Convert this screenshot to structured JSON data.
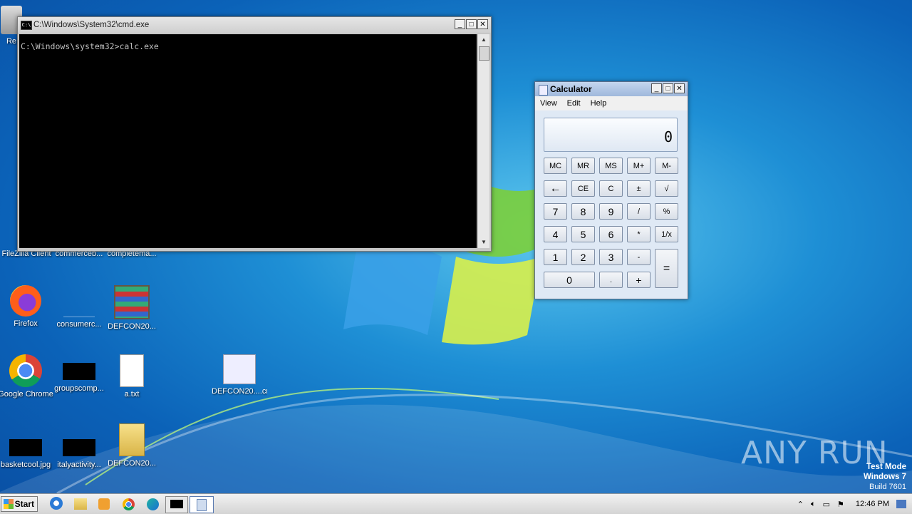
{
  "cmd": {
    "title": "C:\\Windows\\System32\\cmd.exe",
    "icon_text": "C:\\",
    "line": "C:\\Windows\\system32>calc.exe"
  },
  "calculator": {
    "title": "Calculator",
    "menu": [
      "View",
      "Edit",
      "Help"
    ],
    "display": "0",
    "buttons": {
      "mc": "MC",
      "mr": "MR",
      "ms": "MS",
      "mplus": "M+",
      "mminus": "M-",
      "back": "←",
      "ce": "CE",
      "c": "C",
      "pm": "±",
      "sqrt": "√",
      "n7": "7",
      "n8": "8",
      "n9": "9",
      "div": "/",
      "pct": "%",
      "n4": "4",
      "n5": "5",
      "n6": "6",
      "mul": "*",
      "inv": "1/x",
      "n1": "1",
      "n2": "2",
      "n3": "3",
      "sub": "-",
      "eq": "=",
      "n0": "0",
      "dot": ".",
      "add": "+"
    }
  },
  "desktop_icons": [
    {
      "label": "Re"
    },
    {
      "label": "FileZilla Client"
    },
    {
      "label": "commerceb..."
    },
    {
      "label": "completema..."
    },
    {
      "label": "Firefox"
    },
    {
      "label": "consumerc..."
    },
    {
      "label": "DEFCON20..."
    },
    {
      "label": "Google Chrome"
    },
    {
      "label": "groupscomp..."
    },
    {
      "label": "a.txt"
    },
    {
      "label": "DEFCON20....cmd"
    },
    {
      "label": "basketcool.jpg"
    },
    {
      "label": "italyactivity..."
    },
    {
      "label": "DEFCON20..."
    }
  ],
  "taskbar": {
    "start_label": "Start",
    "time": "12:46 PM"
  },
  "watermark": {
    "line1": "Test Mode",
    "line2": "Windows 7",
    "line3": "Build 7601",
    "brand": "ANY RUN"
  }
}
